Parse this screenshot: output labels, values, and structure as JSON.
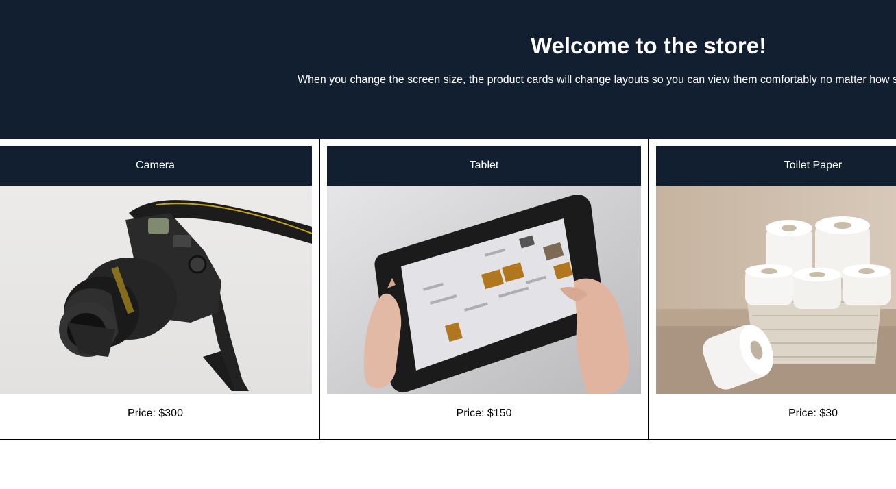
{
  "header": {
    "title": "Welcome to the store!",
    "subtitle": "When you change the screen size, the product cards will change layouts so you can view them comfortably no matter how s"
  },
  "products": [
    {
      "name": "Camera",
      "price": "Price: $300",
      "image_icon": "camera-photo"
    },
    {
      "name": "Tablet",
      "price": "Price: $150",
      "image_icon": "tablet-photo"
    },
    {
      "name": "Toilet Paper",
      "price": "Price: $30",
      "image_icon": "toilet-paper-photo"
    }
  ],
  "colors": {
    "header_bg": "#121f30",
    "card_title_bg": "#121f30",
    "text_light": "#ffffff",
    "text_dark": "#000000",
    "border": "#000000"
  }
}
